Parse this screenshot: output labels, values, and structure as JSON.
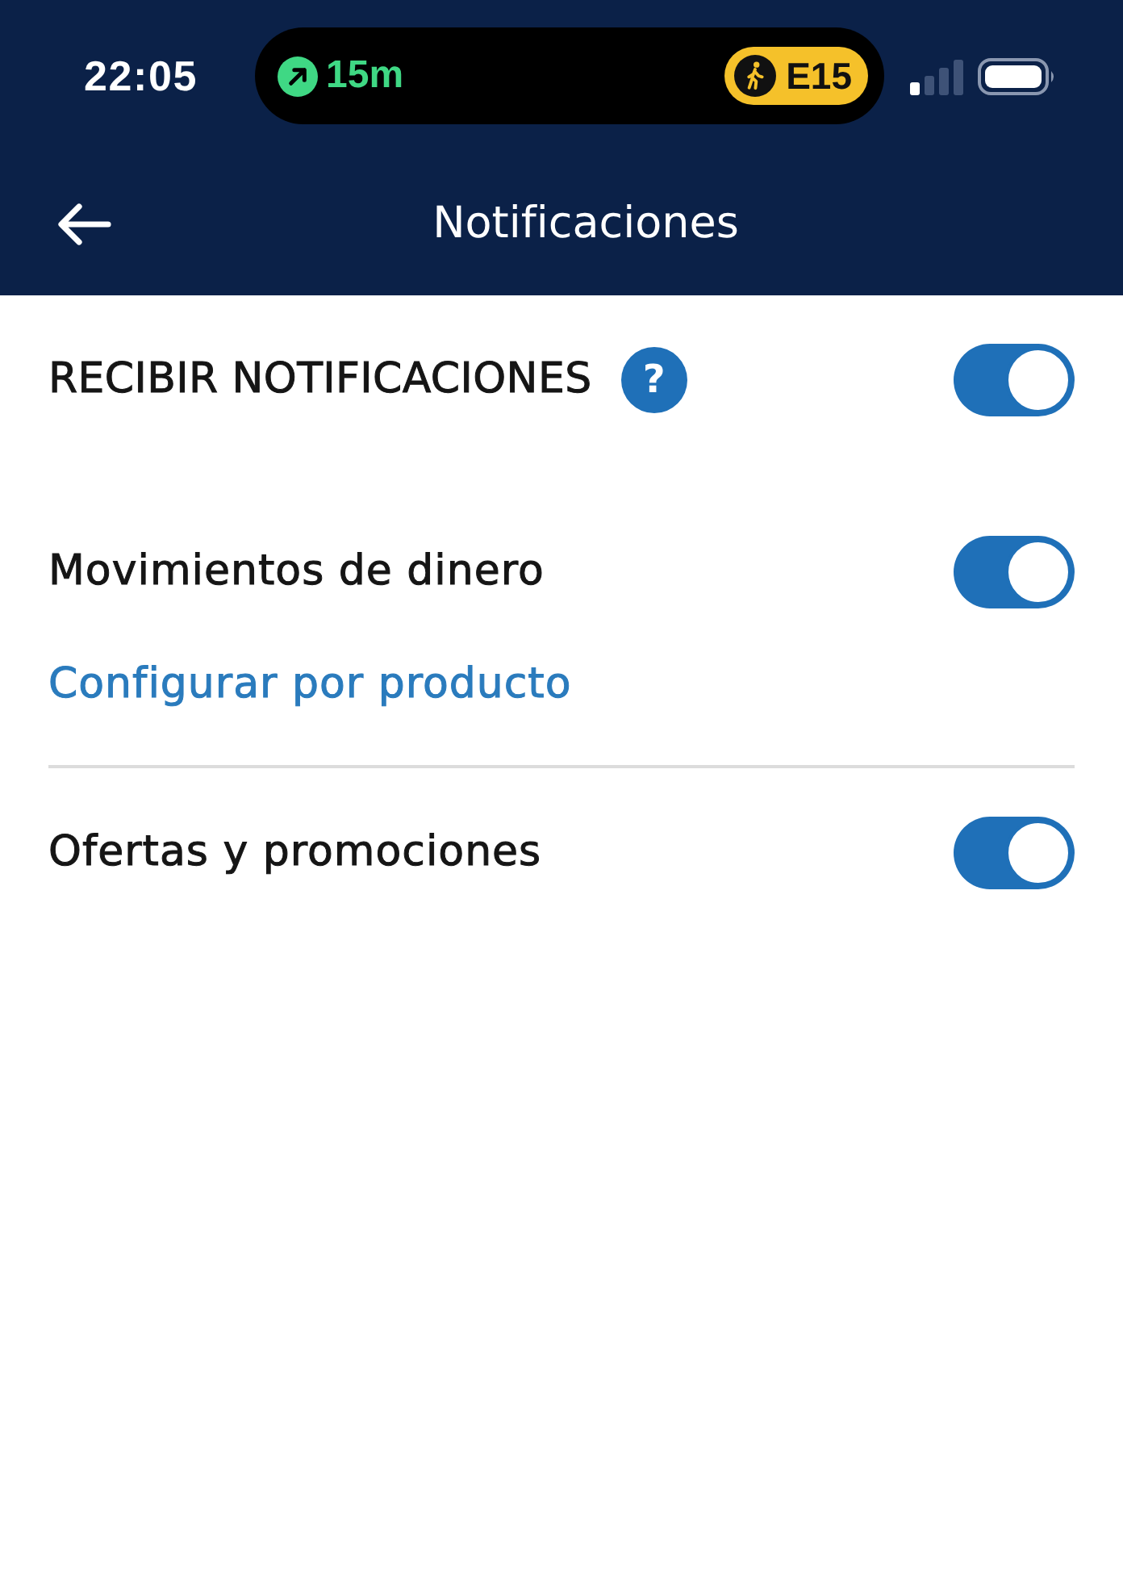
{
  "status_bar": {
    "time": "22:05",
    "live_activity": {
      "eta": "15m",
      "route": "E15"
    }
  },
  "header": {
    "title": "Notificaciones"
  },
  "master": {
    "label": "RECIBIR NOTIFICACIONES",
    "help": "?",
    "on": true
  },
  "groups": [
    {
      "label": "Movimientos de dinero",
      "on": true,
      "link": "Configurar por producto"
    },
    {
      "label": "Ofertas y promociones",
      "on": true
    }
  ]
}
